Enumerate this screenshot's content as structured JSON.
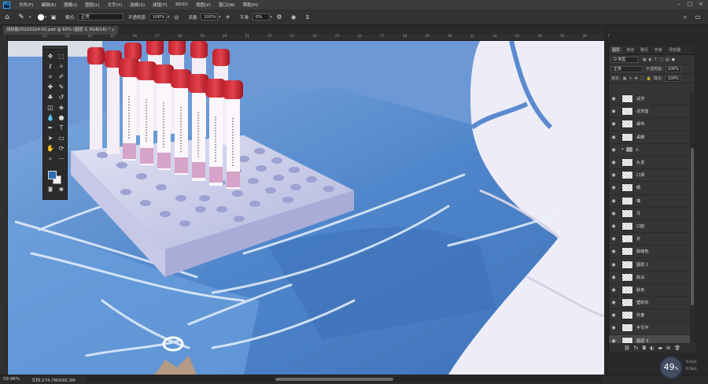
{
  "menu": {
    "items": [
      "文件(F)",
      "编辑(E)",
      "图像(I)",
      "图层(L)",
      "文字(Y)",
      "选择(S)",
      "滤镜(T)",
      "3D(D)",
      "视图(V)",
      "窗口(W)",
      "帮助(H)"
    ]
  },
  "options": {
    "mode_label": "模式:",
    "mode_value": "正常",
    "opacity_label": "不透明度:",
    "opacity_value": "100%",
    "flow_label": "流量:",
    "flow_value": "100%",
    "smooth_label": "平滑:",
    "smooth_value": "0%"
  },
  "document": {
    "tab_title": "测核酸20220324-01.psd @ 60% (图层 3, RGB/16) *",
    "close": "×"
  },
  "ruler": {
    "ticks": [
      "12",
      "13",
      "14",
      "15",
      "16",
      "17",
      "18",
      "19",
      "20",
      "21",
      "22",
      "23",
      "24",
      "25",
      "26",
      "27",
      "28",
      "29",
      "30",
      "31",
      "32",
      "33",
      "34",
      "35",
      "36",
      "37"
    ]
  },
  "panel": {
    "tabs": [
      "图层",
      "通道",
      "路径",
      "色板",
      "导航器"
    ],
    "filter_label": "Q 类型",
    "blend_value": "正常",
    "opacity_label": "不透明度:",
    "opacity_value": "100%",
    "lock_label": "锁定:",
    "fill_label": "填充:",
    "fill_value": "100%"
  },
  "layers": [
    {
      "name": "试剂",
      "type": "layer"
    },
    {
      "name": "试剂盒",
      "type": "layer"
    },
    {
      "name": "桌布",
      "type": "layer"
    },
    {
      "name": "桌脚",
      "type": "layer"
    },
    {
      "name": "人",
      "type": "group"
    },
    {
      "name": "头发",
      "type": "layer"
    },
    {
      "name": "口罩",
      "type": "layer"
    },
    {
      "name": "眼",
      "type": "layer"
    },
    {
      "name": "嘴",
      "type": "layer"
    },
    {
      "name": "牙",
      "type": "layer"
    },
    {
      "name": "口腔",
      "type": "layer"
    },
    {
      "name": "衣",
      "type": "layer"
    },
    {
      "name": "肤暗色",
      "type": "layer"
    },
    {
      "name": "图层 1",
      "type": "layer"
    },
    {
      "name": "肤白",
      "type": "layer"
    },
    {
      "name": "肤色",
      "type": "layer"
    },
    {
      "name": "塑封衣",
      "type": "layer"
    },
    {
      "name": "外套",
      "type": "layer"
    },
    {
      "name": "手写字",
      "type": "layer"
    },
    {
      "name": "图层 3",
      "type": "layer",
      "selected": true
    }
  ],
  "status": {
    "zoom": "59.96%",
    "doc_info": "文档:274.7M/695.3M"
  },
  "zoom_badge": {
    "value": "49",
    "unit": "%"
  },
  "net_stats": [
    "0.1k/s",
    "0.5k/s"
  ]
}
